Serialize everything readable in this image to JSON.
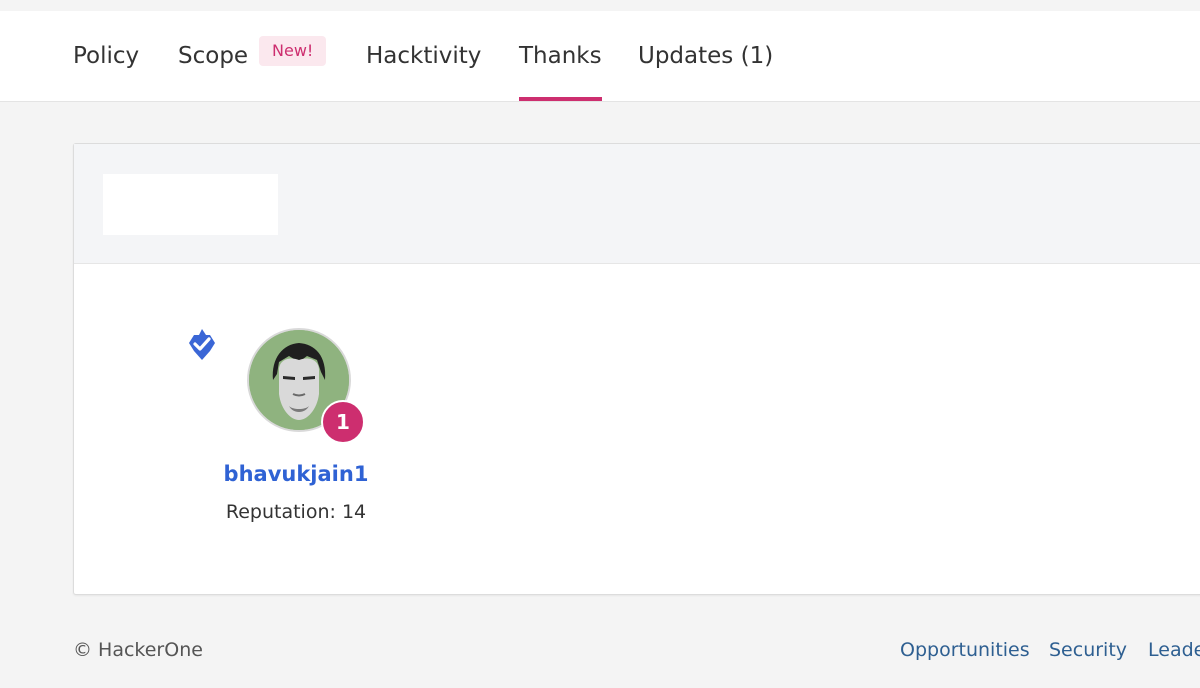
{
  "nav": {
    "tabs": [
      {
        "label": "Policy",
        "active": false
      },
      {
        "label": "Scope",
        "active": false
      },
      {
        "label": "Hacktivity",
        "active": false
      },
      {
        "label": "Thanks",
        "active": true
      },
      {
        "label": "Updates (1)",
        "active": false
      }
    ],
    "new_badge": "New!"
  },
  "thanks": {
    "hacker": {
      "username": "bhavukjain1",
      "reputation": "Reputation: 14",
      "rank": "1",
      "verified": true,
      "avatar_color": "#8fb37f"
    }
  },
  "footer": {
    "copyright": "© HackerOne",
    "links": [
      "Opportunities",
      "Security",
      "Leade"
    ]
  },
  "colors": {
    "accent": "#cd2e6f",
    "link": "#2f62d4",
    "footer_link": "#2e5f91",
    "verified": "#3a66d6"
  }
}
